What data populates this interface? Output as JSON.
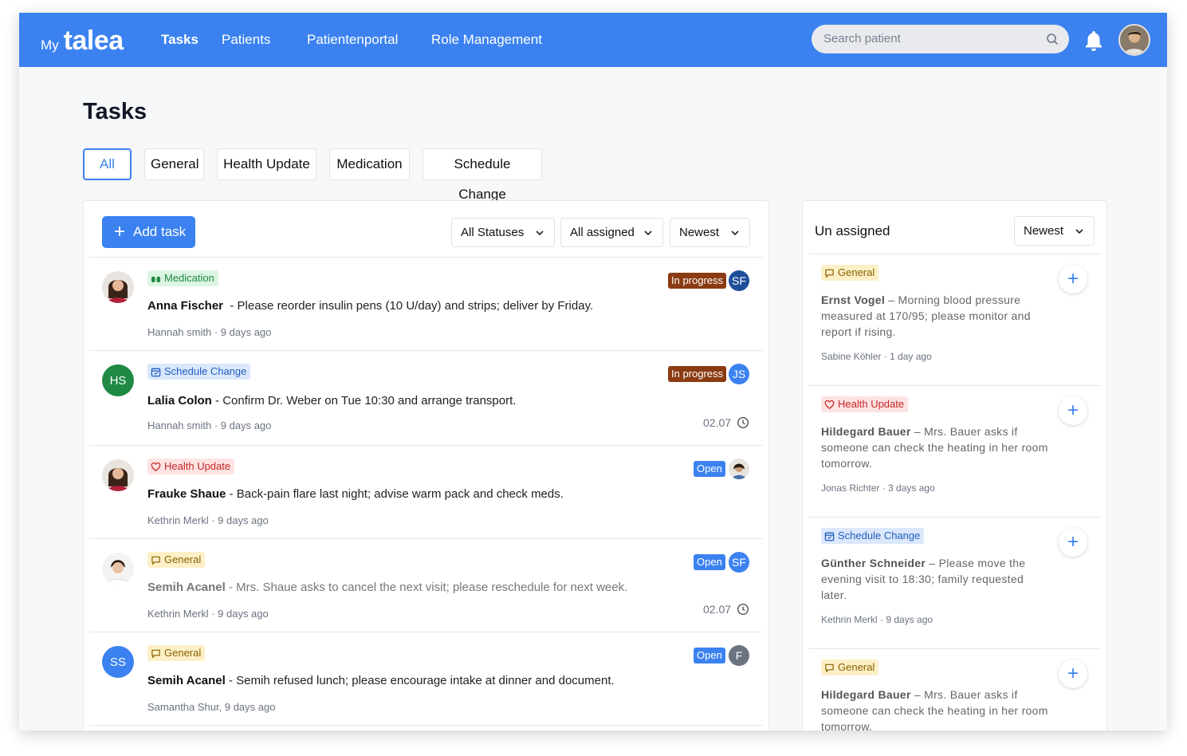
{
  "brand": {
    "prefix": "My",
    "name": "talea"
  },
  "nav": [
    {
      "label": "Tasks",
      "active": true
    },
    {
      "label": "Patients"
    },
    {
      "label": "Patientenportal"
    },
    {
      "label": "Role Management"
    }
  ],
  "search": {
    "placeholder": "Search patient",
    "value": ""
  },
  "icons": {
    "search": "search-icon",
    "bell": "bell-icon",
    "user": "user-avatar"
  },
  "colors": {
    "primary": "#3b82f0",
    "in_progress": "#8a3b12",
    "open": "#3b82f0"
  },
  "page": {
    "title": "Tasks"
  },
  "filter_tabs": [
    "All",
    "General",
    "Health Update",
    "Medication",
    "Schedule Change"
  ],
  "toolbar": {
    "add_label": "Add task",
    "status_filter": "All Statuses",
    "assignee_filter": "All assigned",
    "sort": "Newest"
  },
  "tasks": [
    {
      "tag": "Medication",
      "patient": "Anna Fischer",
      "text": "Please reorder insulin pens (10 U/day) and strips; deliver by Friday.",
      "author": "Hannah smith",
      "time": "9 days ago",
      "status": "In progress",
      "assignee": "SF",
      "due": ""
    },
    {
      "tag": "Schedule Change",
      "patient": "Lalia Colon",
      "avatar_initials": "HS",
      "text": "Confirm Dr. Weber on Tue 10:30 and arrange transport.",
      "author": "Hannah smith",
      "time": "9 days ago",
      "status": "In progress",
      "assignee": "JS",
      "due": "02.07"
    },
    {
      "tag": "Health Update",
      "patient": "Frauke Shaue",
      "text": "Back-pain flare last night; advise warm pack and check meds.",
      "author": "Kethrin Merkl",
      "time": "9 days ago",
      "status": "Open",
      "assignee": "",
      "due": ""
    },
    {
      "tag": "General",
      "patient": "Semih Acanel",
      "text": "Mrs. Shaue asks to cancel the next visit; please reschedule for next week.",
      "author": "Kethrin Merkl",
      "time": "9 days ago",
      "status": "Open",
      "assignee": "SF",
      "due": "02.07"
    },
    {
      "tag": "General",
      "patient": "Semih Acanel",
      "avatar_initials": "SS",
      "text": "Semih refused lunch; please encourage intake at dinner and document.",
      "author": "Samantha Shur,",
      "time": "9 days ago",
      "status": "Open",
      "assignee": "F",
      "due": ""
    }
  ],
  "unassigned": {
    "title": "Un assigned",
    "sort": "Newest",
    "items": [
      {
        "tag": "General",
        "patient": "Ernst Vogel",
        "text": "Morning blood pressure measured at 170/95; please monitor and report if rising.",
        "author": "Sabine Köhler",
        "time": "1 day ago"
      },
      {
        "tag": "Health Update",
        "patient": "Hildegard Bauer",
        "text": "Mrs. Bauer asks if someone can check the heating in her room tomorrow.",
        "author": "Jonas Richter",
        "time": "3 days ago"
      },
      {
        "tag": "Schedule Change",
        "patient": "Günther Schneider",
        "text": "Please move the evening visit to 18:30; family requested later.",
        "author": "Kethrin Merkl",
        "time": "9 days ago"
      },
      {
        "tag": "General",
        "patient": "Hildegard Bauer",
        "text": "Mrs. Bauer asks if someone can check the heating in her room tomorrow.",
        "author": "",
        "time": ""
      }
    ]
  }
}
